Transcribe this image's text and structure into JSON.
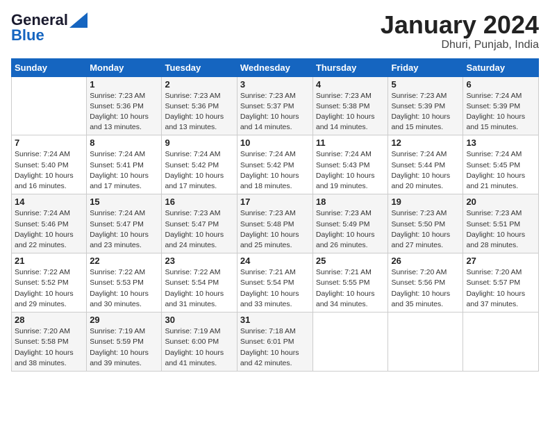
{
  "header": {
    "logo_line1": "General",
    "logo_line2": "Blue",
    "month": "January 2024",
    "location": "Dhuri, Punjab, India"
  },
  "weekdays": [
    "Sunday",
    "Monday",
    "Tuesday",
    "Wednesday",
    "Thursday",
    "Friday",
    "Saturday"
  ],
  "weeks": [
    [
      {
        "num": "",
        "info": ""
      },
      {
        "num": "1",
        "info": "Sunrise: 7:23 AM\nSunset: 5:36 PM\nDaylight: 10 hours\nand 13 minutes."
      },
      {
        "num": "2",
        "info": "Sunrise: 7:23 AM\nSunset: 5:36 PM\nDaylight: 10 hours\nand 13 minutes."
      },
      {
        "num": "3",
        "info": "Sunrise: 7:23 AM\nSunset: 5:37 PM\nDaylight: 10 hours\nand 14 minutes."
      },
      {
        "num": "4",
        "info": "Sunrise: 7:23 AM\nSunset: 5:38 PM\nDaylight: 10 hours\nand 14 minutes."
      },
      {
        "num": "5",
        "info": "Sunrise: 7:23 AM\nSunset: 5:39 PM\nDaylight: 10 hours\nand 15 minutes."
      },
      {
        "num": "6",
        "info": "Sunrise: 7:24 AM\nSunset: 5:39 PM\nDaylight: 10 hours\nand 15 minutes."
      }
    ],
    [
      {
        "num": "7",
        "info": "Sunrise: 7:24 AM\nSunset: 5:40 PM\nDaylight: 10 hours\nand 16 minutes."
      },
      {
        "num": "8",
        "info": "Sunrise: 7:24 AM\nSunset: 5:41 PM\nDaylight: 10 hours\nand 17 minutes."
      },
      {
        "num": "9",
        "info": "Sunrise: 7:24 AM\nSunset: 5:42 PM\nDaylight: 10 hours\nand 17 minutes."
      },
      {
        "num": "10",
        "info": "Sunrise: 7:24 AM\nSunset: 5:42 PM\nDaylight: 10 hours\nand 18 minutes."
      },
      {
        "num": "11",
        "info": "Sunrise: 7:24 AM\nSunset: 5:43 PM\nDaylight: 10 hours\nand 19 minutes."
      },
      {
        "num": "12",
        "info": "Sunrise: 7:24 AM\nSunset: 5:44 PM\nDaylight: 10 hours\nand 20 minutes."
      },
      {
        "num": "13",
        "info": "Sunrise: 7:24 AM\nSunset: 5:45 PM\nDaylight: 10 hours\nand 21 minutes."
      }
    ],
    [
      {
        "num": "14",
        "info": "Sunrise: 7:24 AM\nSunset: 5:46 PM\nDaylight: 10 hours\nand 22 minutes."
      },
      {
        "num": "15",
        "info": "Sunrise: 7:24 AM\nSunset: 5:47 PM\nDaylight: 10 hours\nand 23 minutes."
      },
      {
        "num": "16",
        "info": "Sunrise: 7:23 AM\nSunset: 5:47 PM\nDaylight: 10 hours\nand 24 minutes."
      },
      {
        "num": "17",
        "info": "Sunrise: 7:23 AM\nSunset: 5:48 PM\nDaylight: 10 hours\nand 25 minutes."
      },
      {
        "num": "18",
        "info": "Sunrise: 7:23 AM\nSunset: 5:49 PM\nDaylight: 10 hours\nand 26 minutes."
      },
      {
        "num": "19",
        "info": "Sunrise: 7:23 AM\nSunset: 5:50 PM\nDaylight: 10 hours\nand 27 minutes."
      },
      {
        "num": "20",
        "info": "Sunrise: 7:23 AM\nSunset: 5:51 PM\nDaylight: 10 hours\nand 28 minutes."
      }
    ],
    [
      {
        "num": "21",
        "info": "Sunrise: 7:22 AM\nSunset: 5:52 PM\nDaylight: 10 hours\nand 29 minutes."
      },
      {
        "num": "22",
        "info": "Sunrise: 7:22 AM\nSunset: 5:53 PM\nDaylight: 10 hours\nand 30 minutes."
      },
      {
        "num": "23",
        "info": "Sunrise: 7:22 AM\nSunset: 5:54 PM\nDaylight: 10 hours\nand 31 minutes."
      },
      {
        "num": "24",
        "info": "Sunrise: 7:21 AM\nSunset: 5:54 PM\nDaylight: 10 hours\nand 33 minutes."
      },
      {
        "num": "25",
        "info": "Sunrise: 7:21 AM\nSunset: 5:55 PM\nDaylight: 10 hours\nand 34 minutes."
      },
      {
        "num": "26",
        "info": "Sunrise: 7:20 AM\nSunset: 5:56 PM\nDaylight: 10 hours\nand 35 minutes."
      },
      {
        "num": "27",
        "info": "Sunrise: 7:20 AM\nSunset: 5:57 PM\nDaylight: 10 hours\nand 37 minutes."
      }
    ],
    [
      {
        "num": "28",
        "info": "Sunrise: 7:20 AM\nSunset: 5:58 PM\nDaylight: 10 hours\nand 38 minutes."
      },
      {
        "num": "29",
        "info": "Sunrise: 7:19 AM\nSunset: 5:59 PM\nDaylight: 10 hours\nand 39 minutes."
      },
      {
        "num": "30",
        "info": "Sunrise: 7:19 AM\nSunset: 6:00 PM\nDaylight: 10 hours\nand 41 minutes."
      },
      {
        "num": "31",
        "info": "Sunrise: 7:18 AM\nSunset: 6:01 PM\nDaylight: 10 hours\nand 42 minutes."
      },
      {
        "num": "",
        "info": ""
      },
      {
        "num": "",
        "info": ""
      },
      {
        "num": "",
        "info": ""
      }
    ]
  ]
}
